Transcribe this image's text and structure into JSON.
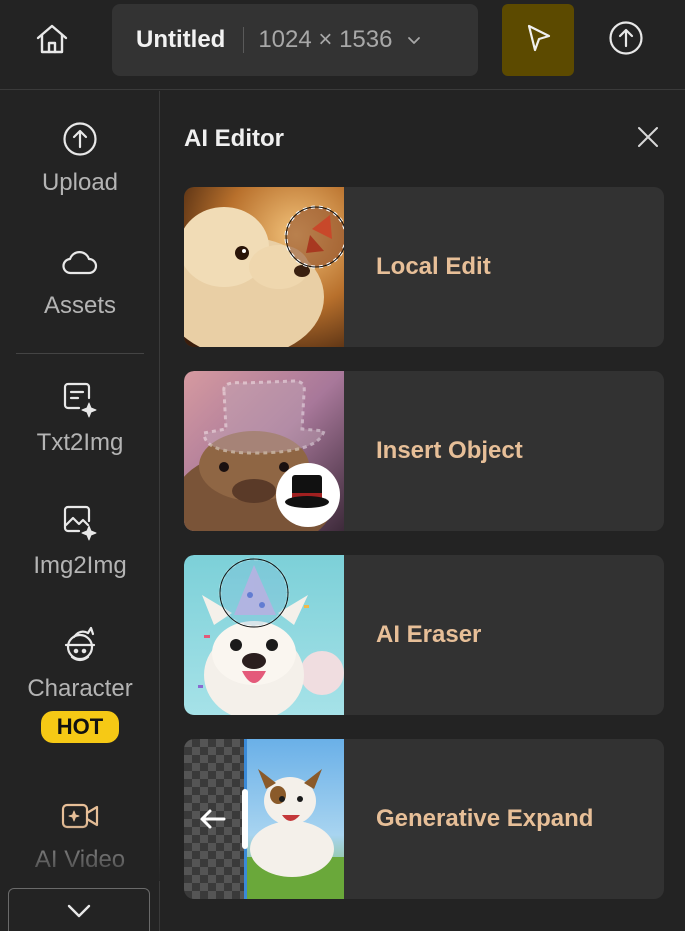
{
  "topbar": {
    "doc_title": "Untitled",
    "doc_dimensions": "1024 × 1536",
    "accent_color": "#5c4a00"
  },
  "sidebar": {
    "items": [
      {
        "label": "Upload",
        "icon": "upload-icon"
      },
      {
        "label": "Assets",
        "icon": "cloud-icon"
      },
      {
        "label": "Txt2Img",
        "icon": "text-to-image-icon"
      },
      {
        "label": "Img2Img",
        "icon": "image-to-image-icon"
      },
      {
        "label": "Character",
        "icon": "character-icon",
        "badge": "HOT"
      },
      {
        "label": "AI Video",
        "icon": "video-camera-icon"
      }
    ],
    "badge_color": "#f6c915"
  },
  "panel": {
    "title": "AI Editor",
    "tools": [
      {
        "label": "Local Edit",
        "thumb": "dog-with-butterfly"
      },
      {
        "label": "Insert Object",
        "thumb": "capybara-with-top-hat"
      },
      {
        "label": "AI Eraser",
        "thumb": "bulldog-with-party-hat"
      },
      {
        "label": "Generative Expand",
        "thumb": "running-terrier"
      }
    ],
    "label_color": "#e7bf98"
  }
}
